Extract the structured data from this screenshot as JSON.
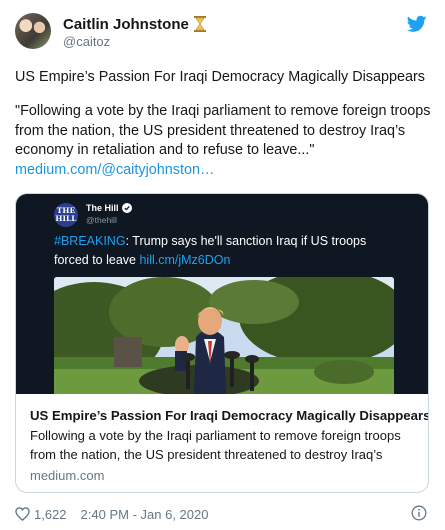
{
  "author": {
    "name": "Caitlin Johnstone",
    "handle": "@caitoz",
    "avatar_icon": "profile-photo",
    "status_emoji": "hourglass-icon"
  },
  "tweet": {
    "title": "US Empire’s Passion For Iraqi Democracy Magically Disappears",
    "quote": "\"Following a vote by the Iraqi parliament to remove foreign troops from the nation, the US president threatened to destroy Iraq’s economy in retaliation and to refuse to leave...\"",
    "link": "medium.com/@caityjohnston…"
  },
  "card": {
    "embedded_tweet": {
      "logo_text": "THE HILL",
      "name": "The Hill",
      "handle": "@thehill",
      "hashtag": "#BREAKING",
      "text": ": Trump says he'll sanction Iraq if US troops forced to leave ",
      "link": "hill.cm/jMz6DOn"
    },
    "title": "US Empire’s Passion For Iraqi Democracy Magically Disappears",
    "description": "Following a vote by the Iraqi parliament to remove foreign troops from the nation, the US president threatened to destroy Iraq’s",
    "domain": "medium.com"
  },
  "footer": {
    "likes": "1,622",
    "timestamp": "2:40 PM - Jan 6, 2020"
  },
  "colors": {
    "link": "#1b95e0",
    "twitter_blue": "#1da1f2",
    "secondary_text": "#657786",
    "border": "#ccd6dd"
  }
}
